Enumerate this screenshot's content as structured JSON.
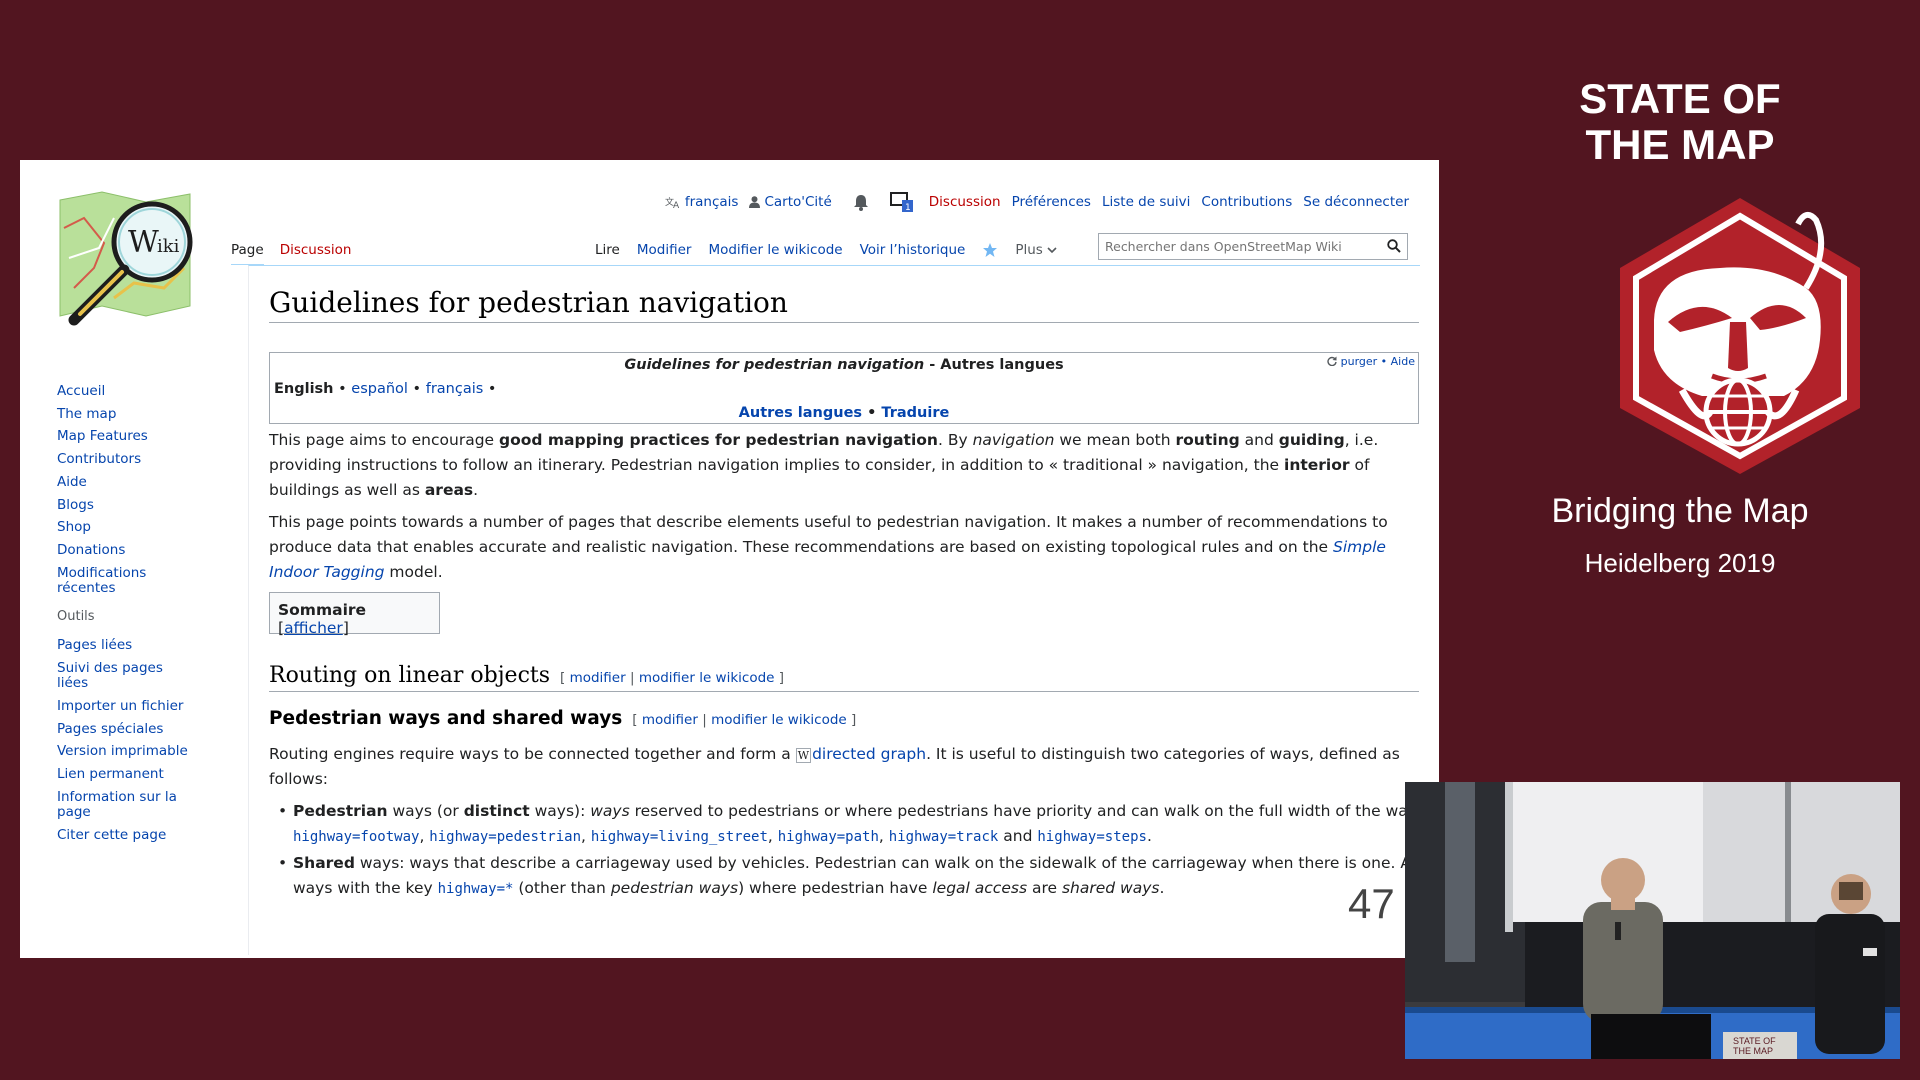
{
  "personal": {
    "language": "français",
    "username": "Carto'Cité",
    "discussion": "Discussion",
    "preferences": "Préférences",
    "watchlist": "Liste de suivi",
    "contributions": "Contributions",
    "logout": "Se déconnecter"
  },
  "nav": {
    "main": [
      "Accueil",
      "The map",
      "Map Features",
      "Contributors",
      "Aide",
      "Blogs",
      "Shop",
      "Donations",
      "Modifications récentes"
    ],
    "tools_heading": "Outils",
    "tools": [
      "Pages liées",
      "Suivi des pages liées",
      "Importer un fichier",
      "Pages spéciales",
      "Version imprimable",
      "Lien permanent",
      "Information sur la page",
      "Citer cette page"
    ]
  },
  "tabs": {
    "page": "Page",
    "discussion": "Discussion",
    "read": "Lire",
    "edit": "Modifier",
    "edit_source": "Modifier le wikicode",
    "history": "Voir l’historique",
    "more": "Plus"
  },
  "search": {
    "placeholder": "Rechercher dans OpenStreetMap Wiki"
  },
  "article": {
    "title": "Guidelines for pedestrian navigation",
    "langbox": {
      "title_italic": "Guidelines for pedestrian navigation",
      "title_suffix": " - Autres langues",
      "purge": "purger",
      "help": "Aide",
      "current_lang": "English",
      "languages": [
        "español",
        "français"
      ],
      "other_languages": "Autres langues",
      "translate": "Traduire"
    },
    "para1": {
      "t1": "This page aims to encourage ",
      "b1": "good mapping practices for pedestrian navigation",
      "t2": ". By ",
      "i1": "navigation",
      "t3": " we mean both ",
      "b2": "routing",
      "t4": " and ",
      "b3": "guiding",
      "t5": ", i.e. providing instructions to follow an itinerary. Pedestrian navigation implies to consider, in addition to « traditional » navigation, the ",
      "b4": "interior",
      "t6": " of buildings as well as ",
      "b5": "areas",
      "t7": "."
    },
    "para2": {
      "t1": "This page points towards a number of pages that describe elements useful to pedestrian navigation. It makes a number of recommendations to produce data that enables accurate and realistic navigation. These recommendations are based on existing topological rules and on the ",
      "link": "Simple Indoor Tagging",
      "t2": " model."
    },
    "toc": {
      "title": "Sommaire",
      "toggle": "afficher"
    },
    "h2": {
      "text": "Routing on linear objects",
      "edit": "modifier",
      "edit_source": "modifier le wikicode"
    },
    "h3": {
      "text": "Pedestrian ways and shared ways",
      "edit": "modifier",
      "edit_source": "modifier le wikicode"
    },
    "para3": {
      "t1": "Routing engines require ways to be connected together and form a ",
      "wlink": "directed graph",
      "t2": ". It is useful to distinguish two categories of ways, defined as follows:"
    },
    "item1": {
      "b1": "Pedestrian",
      "t1": " ways (or ",
      "b2": "distinct",
      "t2": " ways): ",
      "i1": "ways",
      "t3": " reserved to pedestrians or where pedestrians have priority and can walk on the full width of the way:",
      "tags": [
        "highway=footway",
        "highway=pedestrian",
        "highway=living_street",
        "highway=path",
        "highway=track"
      ],
      "and": " and ",
      "last_tag": "highway=steps",
      "end": "."
    },
    "item2": {
      "b1": "Shared",
      "t1": " ways: ways that describe a carriageway used by vehicles. Pedestrian can walk on the sidewalk of the carriageway when there is one. All ways with the key ",
      "tag": "highway=*",
      "t2": " (other than ",
      "i1": "pedestrian ways",
      "t3": ") where pedestrian have ",
      "i2": "legal access",
      "t4": " are ",
      "i3": "shared ways",
      "t5": "."
    }
  },
  "slide_number": "47",
  "brand": {
    "line1": "STATE OF",
    "line2": "THE MAP",
    "event": "Bridging the Map",
    "subtitle": "Heidelberg 2019"
  },
  "video": {
    "banner_text_1": "STATE OF",
    "banner_text_2": "THE MAP"
  },
  "colors": {
    "background": "#521520",
    "brand_red": "#b2222a",
    "link": "#0645ad",
    "new_link": "#ba0000"
  }
}
